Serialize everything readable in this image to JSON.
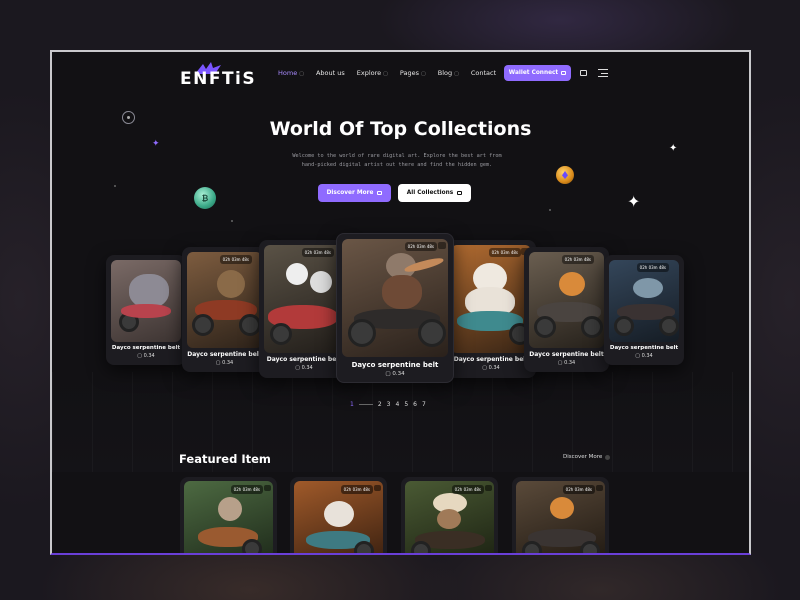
{
  "brand": {
    "name": "ENFTiS"
  },
  "nav": {
    "items": [
      {
        "label": "Home",
        "dropdown": true,
        "active": true
      },
      {
        "label": "About us",
        "dropdown": false,
        "active": false
      },
      {
        "label": "Explore",
        "dropdown": true,
        "active": false
      },
      {
        "label": "Pages",
        "dropdown": true,
        "active": false
      },
      {
        "label": "Blog",
        "dropdown": true,
        "active": false
      },
      {
        "label": "Contact",
        "dropdown": false,
        "active": false
      }
    ],
    "wallet_label": "Wallet Connect"
  },
  "hero": {
    "title": "World Of Top Collections",
    "subtitle_line1": "Welcome to the world of rare digital art. Explore the best art from",
    "subtitle_line2": "hand-picked digital artist out there and find the hidden gem.",
    "discover_label": "Discover More",
    "all_label": "All Collections"
  },
  "carousel": {
    "cards": [
      {
        "title": "Dayco serpentine belt",
        "price": "0.34",
        "timer": "",
        "color": "#6b5a58"
      },
      {
        "title": "Dayco serpentine belt",
        "price": "0.34",
        "timer": "02h 03m 48s",
        "color": "#6a4e39"
      },
      {
        "title": "Dayco serpentine belt",
        "price": "0.34",
        "timer": "02h 03m 48s",
        "color": "#4a4236"
      },
      {
        "title": "Dayco serpentine belt",
        "price": "0.34",
        "timer": "02h 03m 48s",
        "color": "#5a4537"
      },
      {
        "title": "Dayco serpentine belt",
        "price": "0.34",
        "timer": "02h 03m 48s",
        "color": "#9a5a2a"
      },
      {
        "title": "Dayco serpentine belt",
        "price": "0.34",
        "timer": "02h 03m 48s",
        "color": "#5e5448"
      },
      {
        "title": "Dayco serpentine belt",
        "price": "0.34",
        "timer": "02h 03m 48s",
        "color": "#2d3a4a"
      }
    ],
    "pages": [
      "1",
      "2",
      "3",
      "4",
      "5",
      "6",
      "7"
    ],
    "current_page": "1"
  },
  "featured": {
    "title": "Featured Item",
    "discover_label": "Discover More",
    "cards": [
      {
        "timer": "02h 03m 48s",
        "color": "#3f5a38"
      },
      {
        "timer": "02h 03m 48s",
        "color": "#8a4a24"
      },
      {
        "timer": "02h 03m 48s",
        "color": "#3b4a2c"
      },
      {
        "timer": "02h 03m 48s",
        "color": "#4a3a2c"
      }
    ]
  },
  "colors": {
    "accent": "#8f6bff",
    "background": "#121114",
    "card": "#1d1c21"
  }
}
